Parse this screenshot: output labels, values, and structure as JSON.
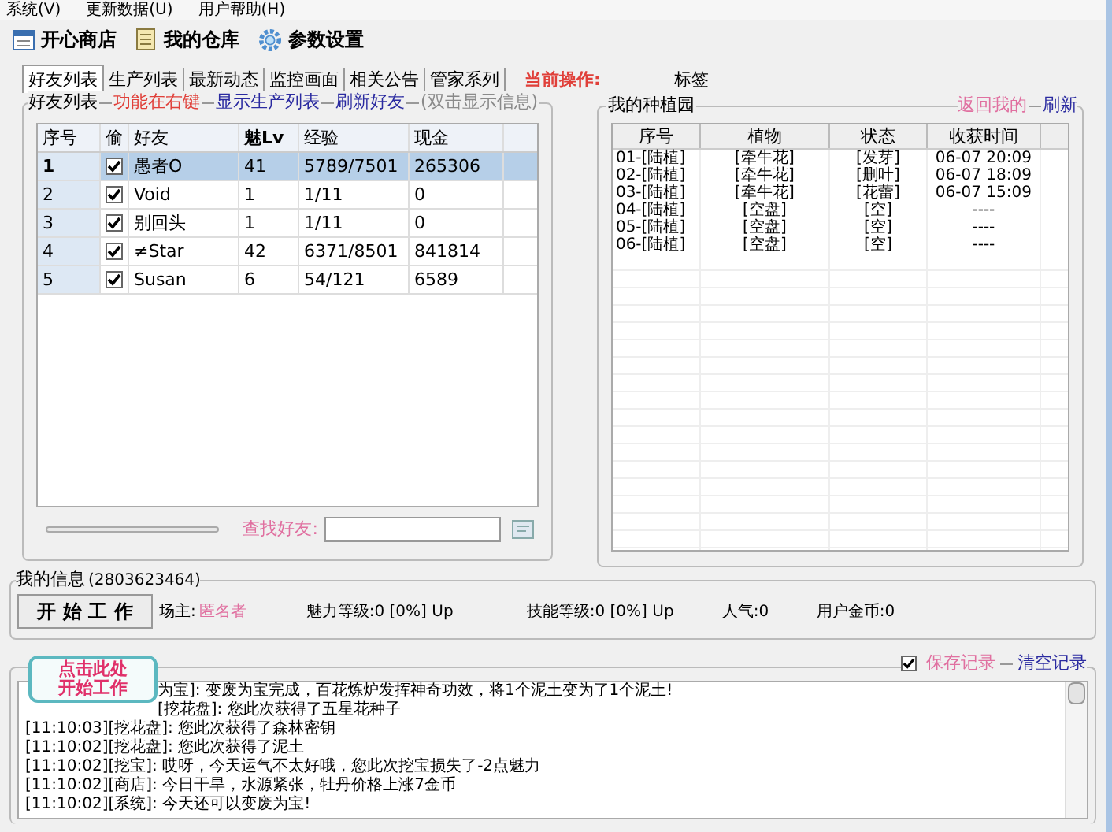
{
  "menu": [
    "系统(V)",
    "更新数据(U)",
    "用户帮助(H)"
  ],
  "toolbar": [
    {
      "label": "开心商店",
      "kind": "shop"
    },
    {
      "label": "我的仓库",
      "kind": "store"
    },
    {
      "label": "参数设置",
      "kind": "gear"
    }
  ],
  "tabs": [
    {
      "label": "好友列表",
      "selected": true
    },
    {
      "label": "生产列表",
      "selected": false
    },
    {
      "label": "最新动态",
      "selected": false
    },
    {
      "label": "监控画面",
      "selected": false
    },
    {
      "label": "相关公告",
      "selected": false
    },
    {
      "label": "管家系列",
      "selected": false
    }
  ],
  "current_op": {
    "label": "当前操作:",
    "value": "标签"
  },
  "friends": {
    "title": "好友列表",
    "links": [
      {
        "label": "功能在右键",
        "kind": "red"
      },
      {
        "label": "显示生产列表",
        "kind": "blue"
      },
      {
        "label": "刷新好友",
        "kind": "blue"
      },
      {
        "label": "(双击显示信息)",
        "kind": "grey"
      }
    ],
    "columns": [
      "序号",
      "偷",
      "好友",
      "魅Lv",
      "经验",
      "现金"
    ],
    "rows": [
      {
        "no": "1",
        "checked": true,
        "friend": "愚者O",
        "lv": "41",
        "exp": "5789/7501",
        "cash": "265306",
        "selected": true
      },
      {
        "no": "2",
        "checked": true,
        "friend": "Void",
        "lv": "1",
        "exp": "1/11",
        "cash": "0",
        "selected": false
      },
      {
        "no": "3",
        "checked": true,
        "friend": "别回头",
        "lv": "1",
        "exp": "1/11",
        "cash": "0",
        "selected": false
      },
      {
        "no": "4",
        "checked": true,
        "friend": "≠Star",
        "lv": "42",
        "exp": "6371/8501",
        "cash": "841814",
        "selected": false
      },
      {
        "no": "5",
        "checked": true,
        "friend": "Susan",
        "lv": "6",
        "exp": "54/121",
        "cash": "6589",
        "selected": false
      }
    ],
    "search_label": "查找好友:"
  },
  "garden": {
    "title": "我的种植园",
    "links": [
      {
        "label": "返回我的",
        "kind": "pink"
      },
      {
        "label": "刷新",
        "kind": "blue"
      }
    ],
    "columns": [
      "序号",
      "植物",
      "状态",
      "收获时间"
    ],
    "rows": [
      [
        "01-[陆植]",
        "[牵牛花]",
        "[发芽]",
        "06-07 20:09"
      ],
      [
        "02-[陆植]",
        "[牵牛花]",
        "[删叶]",
        "06-07 18:09"
      ],
      [
        "03-[陆植]",
        "[牵牛花]",
        "[花蕾]",
        "06-07 15:09"
      ],
      [
        "04-[陆植]",
        "[空盘]",
        "[空]",
        "----"
      ],
      [
        "05-[陆植]",
        "[空盘]",
        "[空]",
        "----"
      ],
      [
        "06-[陆植]",
        "[空盘]",
        "[空]",
        "----"
      ]
    ]
  },
  "info": {
    "title": "我的信息",
    "qq": "(2803623464)",
    "start_button": "开 始 工 作",
    "owner_label": "场主:",
    "owner": "匿名者",
    "stats": [
      "魅力等级:0 [0%] Up",
      "技能等级:0 [0%] Up",
      "人气:0",
      "用户金币:0"
    ]
  },
  "tooltip": {
    "lines": [
      "点击此处",
      "开始工作"
    ]
  },
  "log": {
    "save": {
      "label": "保存记录",
      "checked": true
    },
    "clear": "清空记录",
    "lines": [
      {
        "text": "为宝]: 变废为宝完成，百花炼炉发挥神奇功效，将1个泥土变为了1个泥土!",
        "covered": true
      },
      {
        "text": "[挖花盘]: 您此次获得了五星花种子",
        "covered": true
      },
      {
        "text": "[11:10:03][挖花盘]: 您此次获得了森林密钥"
      },
      {
        "text": "[11:10:02][挖花盘]: 您此次获得了泥土"
      },
      {
        "text": "[11:10:02][挖宝]: 哎呀，今天运气不太好哦，您此次挖宝损失了-2点魅力"
      },
      {
        "text": "[11:10:02][商店]: 今日干旱，水源紧张，牡丹价格上涨7金币"
      },
      {
        "text": "[11:10:02][系统]: 今天还可以变废为宝!"
      }
    ]
  }
}
